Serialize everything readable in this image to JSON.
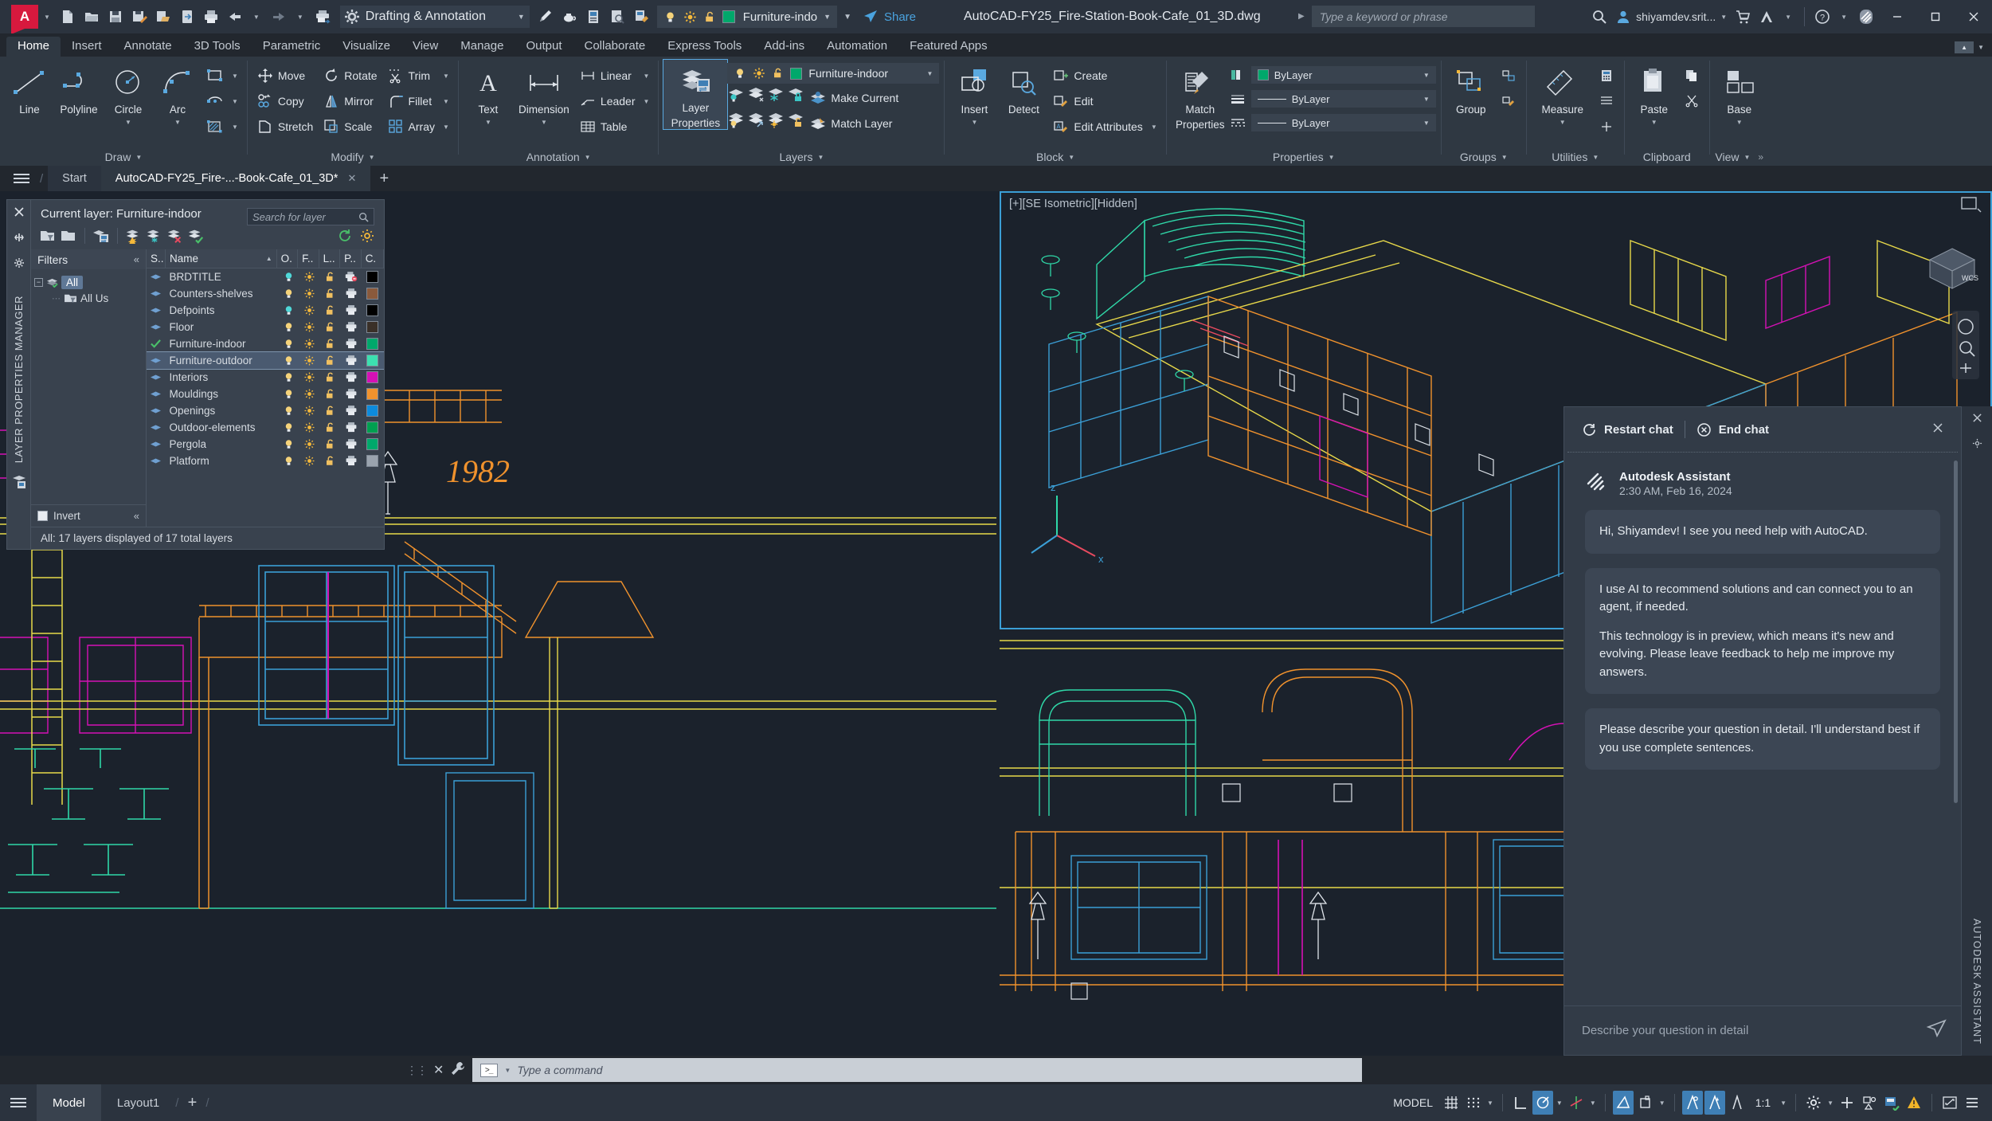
{
  "titlebar": {
    "workspace": "Drafting & Annotation",
    "layer_current": "Furniture-indo",
    "share_label": "Share",
    "document_title": "AutoCAD-FY25_Fire-Station-Book-Cafe_01_3D.dwg",
    "search_placeholder": "Type a keyword or phrase",
    "user": "shiyamdev.srit...",
    "quick_access": [
      "new-icon",
      "open-icon",
      "save-icon",
      "saveas-icon",
      "export-icon",
      "cloud-open-icon",
      "plot-icon",
      "undo-icon",
      "redo-icon",
      "plot-batch-icon"
    ],
    "right_icons": [
      "search-icon",
      "cart-icon",
      "autodesk-icon",
      "help-icon",
      "assistant-icon"
    ],
    "window_buttons": [
      "minimize",
      "maximize",
      "close"
    ]
  },
  "ribbon": {
    "tabs": [
      "Home",
      "Insert",
      "Annotate",
      "3D Tools",
      "Parametric",
      "Visualize",
      "View",
      "Manage",
      "Output",
      "Collaborate",
      "Express Tools",
      "Add-ins",
      "Automation",
      "Featured Apps"
    ],
    "active_tab": "Home",
    "panels": {
      "draw": {
        "title": "Draw",
        "big": [
          {
            "label": "Line",
            "icon": "line-icon",
            "dropdown": false
          },
          {
            "label": "Polyline",
            "icon": "polyline-icon",
            "dropdown": false
          },
          {
            "label": "Circle",
            "icon": "circle-icon",
            "dropdown": true
          },
          {
            "label": "Arc",
            "icon": "arc-icon",
            "dropdown": true
          }
        ],
        "small": [
          {
            "label": "",
            "icon": "rectangle-icon",
            "dropdown": true
          },
          {
            "label": "",
            "icon": "ellipse-icon",
            "dropdown": true
          },
          {
            "label": "",
            "icon": "hatch-icon",
            "dropdown": true
          }
        ]
      },
      "modify": {
        "title": "Modify",
        "items": [
          {
            "label": "Move",
            "icon": "move-icon"
          },
          {
            "label": "Rotate",
            "icon": "rotate-icon"
          },
          {
            "label": "Trim",
            "icon": "trim-icon",
            "dropdown": true
          },
          {
            "label": "Copy",
            "icon": "copy-icon"
          },
          {
            "label": "Mirror",
            "icon": "mirror-icon"
          },
          {
            "label": "Fillet",
            "icon": "fillet-icon",
            "dropdown": true
          },
          {
            "label": "Stretch",
            "icon": "stretch-icon"
          },
          {
            "label": "Scale",
            "icon": "scale-icon"
          },
          {
            "label": "Array",
            "icon": "array-icon",
            "dropdown": true
          }
        ]
      },
      "annotation": {
        "title": "Annotation",
        "big": [
          {
            "label": "Text",
            "icon": "text-icon"
          },
          {
            "label": "Dimension",
            "icon": "dimension-icon"
          }
        ],
        "small": [
          {
            "label": "Linear",
            "icon": "linear-dim-icon",
            "dropdown": true
          },
          {
            "label": "Leader",
            "icon": "leader-icon",
            "dropdown": true
          },
          {
            "label": "Table",
            "icon": "table-icon",
            "dropdown": false
          }
        ]
      },
      "layers": {
        "title": "Layers",
        "big_label_1": "Layer",
        "big_label_2": "Properties",
        "current_layer": "Furniture-indoor",
        "make_current": "Make Current",
        "match_layer": "Match Layer"
      },
      "block": {
        "title": "Block",
        "big": [
          {
            "label": "Insert",
            "icon": "insert-block-icon",
            "dropdown": true
          },
          {
            "label": "Detect",
            "icon": "detect-block-icon"
          }
        ],
        "small": [
          {
            "label": "Create",
            "icon": "create-block-icon"
          },
          {
            "label": "Edit",
            "icon": "edit-block-icon"
          },
          {
            "label": "Edit Attributes",
            "icon": "edit-attributes-icon",
            "dropdown": true
          }
        ]
      },
      "properties": {
        "title": "Properties",
        "big_label_1": "Match",
        "big_label_2": "Properties",
        "color": "ByLayer",
        "linewidth": "ByLayer",
        "linetype": "ByLayer"
      },
      "groups": {
        "title": "Groups",
        "label": "Group"
      },
      "utilities": {
        "title": "Utilities",
        "label": "Measure"
      },
      "clipboard": {
        "title": "Clipboard",
        "label": "Paste"
      },
      "view": {
        "title": "View",
        "label": "Base"
      }
    }
  },
  "file_tabs": {
    "start": "Start",
    "documents": [
      {
        "label": "AutoCAD-FY25_Fire-...-Book-Cafe_01_3D*",
        "active": true
      }
    ],
    "new_tab": "+"
  },
  "layer_manager": {
    "panel_title": "LAYER PROPERTIES MANAGER",
    "current_layer_label": "Current layer: Furniture-indoor",
    "search_placeholder": "Search for layer",
    "filters_header": "Filters",
    "filters_collapse": "«",
    "filter_tree": [
      {
        "label": "All",
        "selected": true
      },
      {
        "label": "All Us",
        "selected": false
      }
    ],
    "invert_label": "Invert",
    "invert_collapse": "«",
    "columns": [
      "S..",
      "Name",
      "O.",
      "F..",
      "L..",
      "P..",
      "C."
    ],
    "status": "All: 17 layers displayed of 17 total layers",
    "layers": [
      {
        "name": "BRDTITLE",
        "status": "normal",
        "on": "cyan",
        "freeze": "on",
        "lock": "unlocked",
        "plot": "noplot",
        "color": "#000000",
        "selected": false
      },
      {
        "name": "Counters-shelves",
        "status": "normal",
        "on": "yellow",
        "freeze": "on",
        "lock": "unlocked",
        "plot": "plot",
        "color": "#8a5a3c",
        "selected": false
      },
      {
        "name": "Defpoints",
        "status": "normal",
        "on": "cyan",
        "freeze": "on",
        "lock": "unlocked",
        "plot": "plot",
        "color": "#000000",
        "selected": false
      },
      {
        "name": "Floor",
        "status": "normal",
        "on": "yellow",
        "freeze": "on",
        "lock": "unlocked",
        "plot": "plot",
        "color": "#3a3028",
        "selected": false
      },
      {
        "name": "Furniture-indoor",
        "status": "current",
        "on": "yellow",
        "freeze": "on",
        "lock": "unlocked",
        "plot": "plot",
        "color": "#00a86b",
        "selected": false
      },
      {
        "name": "Furniture-outdoor",
        "status": "normal",
        "on": "yellow",
        "freeze": "on",
        "lock": "unlocked",
        "plot": "plot",
        "color": "#3ce0b0",
        "selected": true
      },
      {
        "name": "Interiors",
        "status": "normal",
        "on": "yellow",
        "freeze": "on",
        "lock": "unlocked",
        "plot": "plot",
        "color": "#d511b5",
        "selected": false
      },
      {
        "name": "Mouldings",
        "status": "normal",
        "on": "yellow",
        "freeze": "on",
        "lock": "unlocked",
        "plot": "plot",
        "color": "#f0922d",
        "selected": false
      },
      {
        "name": "Openings",
        "status": "normal",
        "on": "yellow",
        "freeze": "on",
        "lock": "unlocked",
        "plot": "plot",
        "color": "#0d8bdc",
        "selected": false
      },
      {
        "name": "Outdoor-elements",
        "status": "normal",
        "on": "yellow",
        "freeze": "on",
        "lock": "unlocked",
        "plot": "plot",
        "color": "#00a050",
        "selected": false
      },
      {
        "name": "Pergola",
        "status": "normal",
        "on": "yellow",
        "freeze": "on",
        "lock": "unlocked",
        "plot": "plot",
        "color": "#00a86b",
        "selected": false
      },
      {
        "name": "Platform",
        "status": "normal",
        "on": "yellow",
        "freeze": "on",
        "lock": "unlocked",
        "plot": "plot",
        "color": "#9aa3ae",
        "selected": false
      }
    ]
  },
  "viewports": {
    "top_right_label": "[+][SE Isometric][Hidden]",
    "drawing_year_text": "1982"
  },
  "assistant": {
    "rail_label": "AUTODESK ASSISTANT",
    "restart_label": "Restart chat",
    "end_label": "End chat",
    "sender": "Autodesk Assistant",
    "timestamp": "2:30 AM, Feb 16, 2024",
    "messages": [
      {
        "text": "Hi, Shiyamdev! I see you need help with AutoCAD."
      },
      {
        "text": "I use AI to recommend solutions and can connect you to an agent, if needed.",
        "text2": "This technology is in preview, which means it's new and evolving. Please leave feedback to help me improve my answers."
      },
      {
        "text": "Please describe your question in detail. I'll understand best if you use complete sentences."
      }
    ],
    "input_placeholder": "Describe your question in detail",
    "send_icon": "send-icon"
  },
  "command_line": {
    "placeholder": "Type a command",
    "close_icon": "x-icon",
    "customize_icon": "wrench-icon"
  },
  "status_bar": {
    "layout_tabs": [
      {
        "label": "Model",
        "active": true
      },
      {
        "label": "Layout1",
        "active": false
      }
    ],
    "add_tab": "+",
    "model_label": "MODEL",
    "scale": "1:1",
    "right_items": [
      {
        "name": "grid-icon",
        "on": false
      },
      {
        "name": "snap-icon",
        "on": false
      },
      {
        "name": "ortho-icon",
        "on": false
      },
      {
        "name": "polar-tracking-icon",
        "on": true
      },
      {
        "name": "isodraft-icon",
        "on": false
      },
      {
        "name": "osnap-icon",
        "on": true
      },
      {
        "name": "3dosnap-icon",
        "on": false
      },
      {
        "name": "otrack-icon",
        "on": true
      },
      {
        "name": "dynamic-ucs-icon",
        "on": true
      },
      {
        "name": "dyn-input-icon",
        "on": false
      },
      {
        "name": "annotation-scale-icon",
        "on": false
      },
      {
        "name": "gear-icon",
        "on": false
      },
      {
        "name": "add-icon",
        "on": false
      },
      {
        "name": "isolate-icon",
        "on": false
      },
      {
        "name": "hardware-accel-icon",
        "on": false
      },
      {
        "name": "cleanscreen-icon",
        "on": false
      },
      {
        "name": "fullscreen-icon",
        "on": false
      },
      {
        "name": "customization-icon",
        "on": false
      }
    ]
  }
}
